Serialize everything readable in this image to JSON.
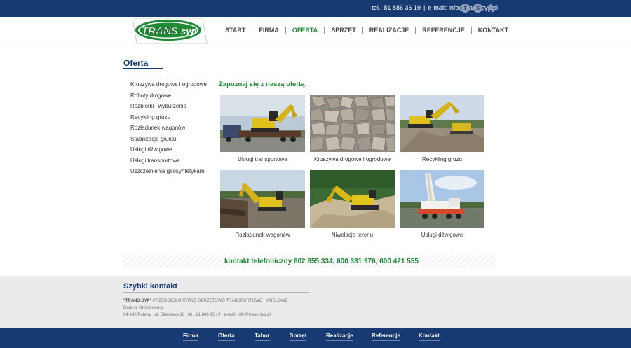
{
  "topbar": {
    "phone": "tel.: 81 886 36 19",
    "separator": "|",
    "email": "e-mail: info@trans-syp.pl",
    "icons": [
      "facebook-icon",
      "skype-icon",
      "home-icon"
    ]
  },
  "logo": {
    "text_main": "TRANS",
    "text_sub": "syp"
  },
  "nav": {
    "items": [
      "START",
      "FIRMA",
      "OFERTA",
      "SPRZĘT",
      "REALIZACJE",
      "REFERENCJE",
      "KONTAKT"
    ],
    "active": "OFERTA"
  },
  "section": {
    "title": "Oferta"
  },
  "sidebar": {
    "items": [
      "Kruszywa drogowe i ogrodowe",
      "Roboty drogowe",
      "Rozbiórki i wyburzenia",
      "Recykling gruzu",
      "Rozładunek wagonów",
      "Stabilizacje gruntu",
      "Usługi dźwigowe",
      "Usługi transportowe",
      "Uszczelnienia geosyntetykami"
    ]
  },
  "offer": {
    "heading": "Zapoznaj się z naszą ofertą",
    "tiles": [
      "Usługi transportowe",
      "Kruszywa drogowe i ogrodowe",
      "Recykling gruzu",
      "Rozładunek wagonów",
      "Niwelacja terenu",
      "Usługi dźwigowe"
    ]
  },
  "phones": {
    "text": "kontakt telefoniczny  602 655 334,  600 331 976,  600 421 555"
  },
  "quick": {
    "title": "Szybki kontakt",
    "company": "\"TRANS-SYP\"",
    "company_desc": " PRZEDSIĘBIORSTWO SPRZĘTOWO TRANSPORTOWO HANDLOWE",
    "person": "Dariusz Omilianowicz",
    "address": "24-100 Puławy , ul. Składowa 10 , tel.: 81 886 36 19 , e-mail: info@trans-syp.pl"
  },
  "footer": {
    "items": [
      "Firma",
      "Oferta",
      "Tabor",
      "Sprzęt",
      "Realizacje",
      "Referencje",
      "Kontakt"
    ]
  },
  "colors": {
    "navy": "#173a72",
    "green": "#1e8a35"
  }
}
